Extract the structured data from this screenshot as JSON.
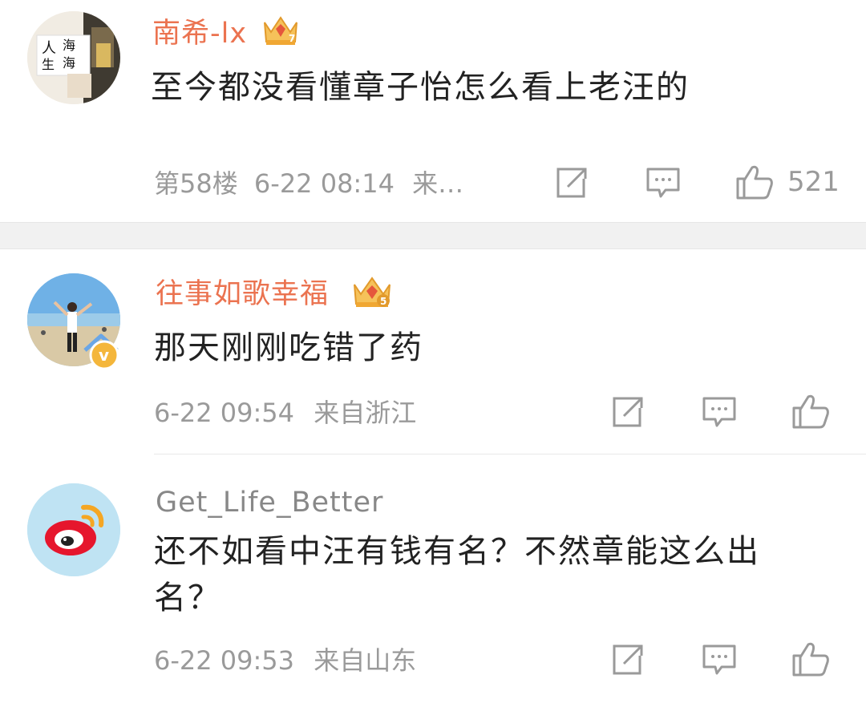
{
  "comments": [
    {
      "username": "南希-lx",
      "badge_icon": "crown-badge-level-7-icon",
      "badge_level": "7",
      "text": "至今都没看懂章子怡怎么看上老汪的",
      "floor": "第58楼",
      "time": "6-22 08:14",
      "source": "来…",
      "like_count": "521",
      "avatar_text_1": "人",
      "avatar_text_2": "海",
      "avatar_text_3": "生",
      "avatar_text_4": "海"
    },
    {
      "username": "往事如歌幸福",
      "badge_icon": "crown-badge-level-5-icon",
      "badge_level": "5",
      "text": "那天刚刚吃错了药",
      "time": "6-22 09:54",
      "source": "来自浙江",
      "verified_icon": "verified-v-icon",
      "verified_letter": "v"
    },
    {
      "username": "Get_Life_Better",
      "text": "还不如看中汪有钱有名？不然章能这么出名？",
      "time": "6-22 09:53",
      "source": "来自山东",
      "avatar_icon": "weibo-logo-icon"
    }
  ],
  "colors": {
    "vip_name": "#eb7350",
    "normal_name": "#888888",
    "meta": "#9a9a9a",
    "text": "#222222",
    "separator": "#f1f1f1"
  },
  "icons": {
    "repost": "repost-icon",
    "comment": "comment-icon",
    "like": "thumbs-up-icon"
  }
}
